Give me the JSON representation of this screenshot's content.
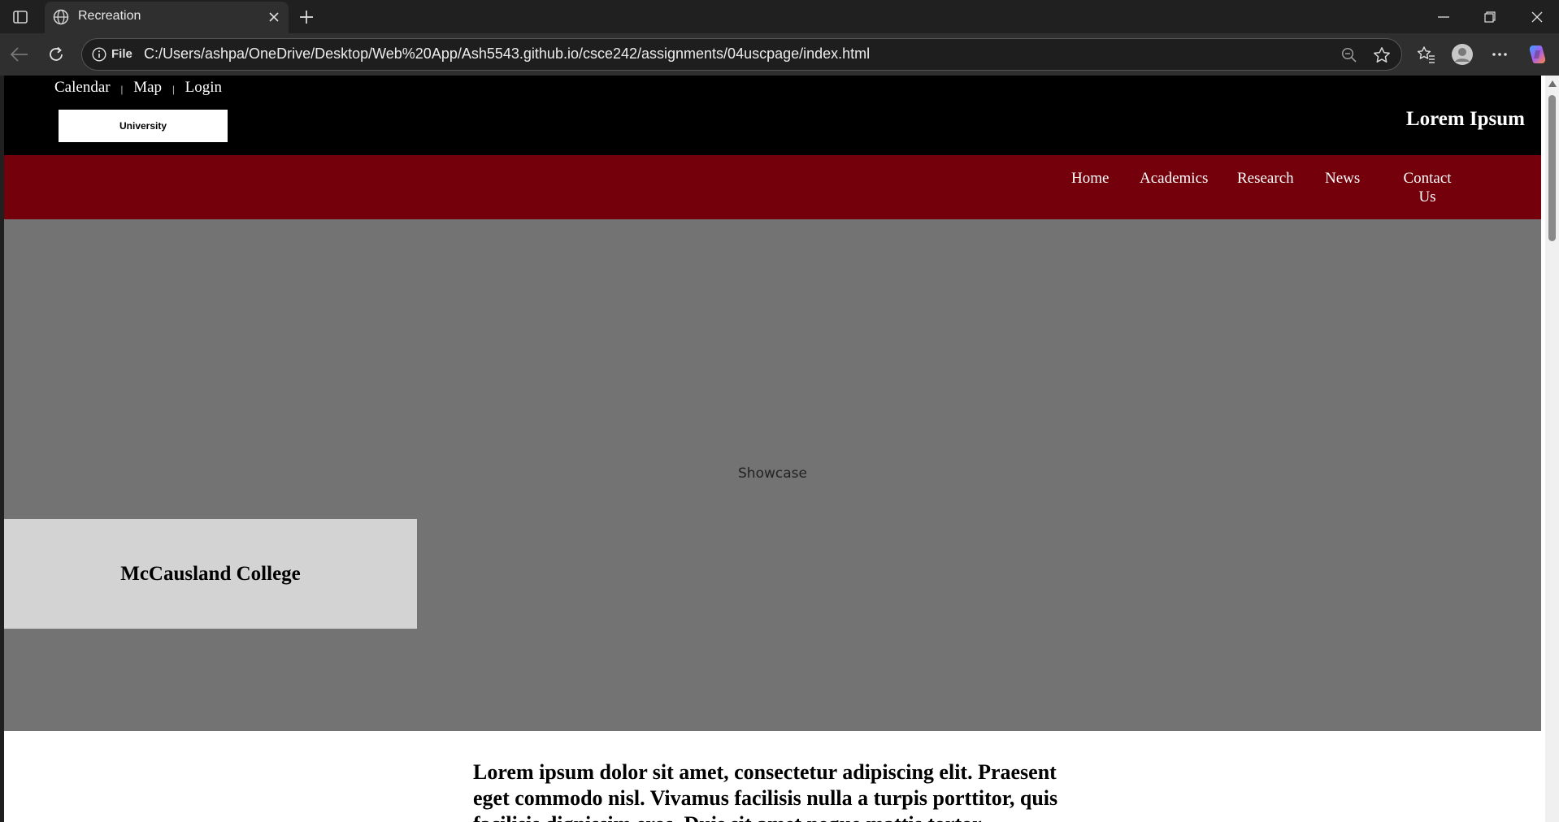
{
  "browser": {
    "tab": {
      "title": "Recreation"
    },
    "address": {
      "scheme": "File",
      "url": "C:/Users/ashpa/OneDrive/Desktop/Web%20App/Ash5543.github.io/csce242/assignments/04uscpage/index.html"
    }
  },
  "page": {
    "util_links": [
      "Calendar",
      "Map",
      "Login"
    ],
    "util_separator": "|",
    "logo_text": "University",
    "site_title": "Lorem Ipsum",
    "nav": {
      "home": "Home",
      "academics": "Academics",
      "research": "Research",
      "news": "News",
      "contact_line1": "Contact",
      "contact_line2": "Us"
    },
    "showcase_label": "Showcase",
    "college_name": "McCausland College",
    "intro_text": "Lorem ipsum dolor sit amet, consectetur adipiscing elit. Praesent eget commodo nisl. Vivamus facilisis nulla a turpis porttitor, quis facilisis dignissim eros. Duis sit amet neque mattis tortor"
  },
  "colors": {
    "nav_bg": "#73000a",
    "topbar_bg": "#000000",
    "showcase_bg": "#737373",
    "college_box_bg": "#d3d3d3"
  }
}
